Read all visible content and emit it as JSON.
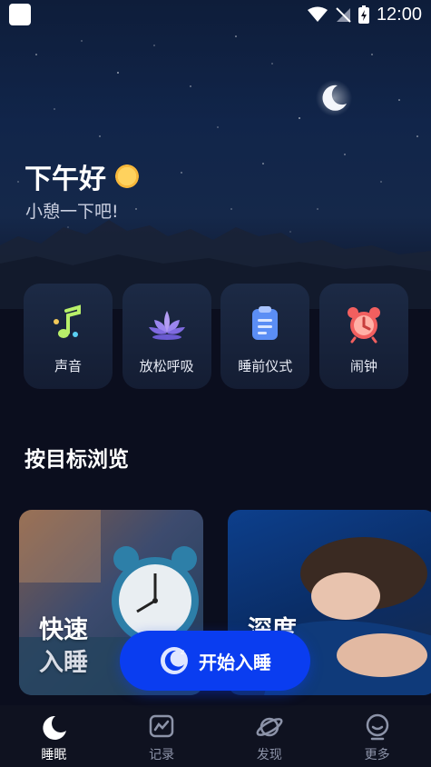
{
  "status_bar": {
    "time": "12:00"
  },
  "header": {
    "greeting": "下午好",
    "subtitle": "小憩一下吧!"
  },
  "features": [
    {
      "label": "声音",
      "icon": "music-note-icon"
    },
    {
      "label": "放松呼吸",
      "icon": "lotus-icon"
    },
    {
      "label": "睡前仪式",
      "icon": "clipboard-icon"
    },
    {
      "label": "闹钟",
      "icon": "alarm-clock-icon"
    }
  ],
  "browse": {
    "title": "按目标浏览",
    "cards": [
      {
        "line1": "快速",
        "line2": "入睡",
        "image": "alarm-clock-photo"
      },
      {
        "line1": "深度",
        "line2": "",
        "image": "sleeping-woman-photo"
      }
    ]
  },
  "start_button": {
    "label": "开始入睡",
    "icon": "moon-icon"
  },
  "tabs": [
    {
      "label": "睡眠",
      "icon": "moon-icon",
      "active": true
    },
    {
      "label": "记录",
      "icon": "chart-icon",
      "active": false
    },
    {
      "label": "发现",
      "icon": "planet-icon",
      "active": false
    },
    {
      "label": "更多",
      "icon": "face-icon",
      "active": false
    }
  ],
  "colors": {
    "accent": "#0a3df0",
    "background": "#0b0e1e",
    "tab_bar": "#0f1220"
  }
}
